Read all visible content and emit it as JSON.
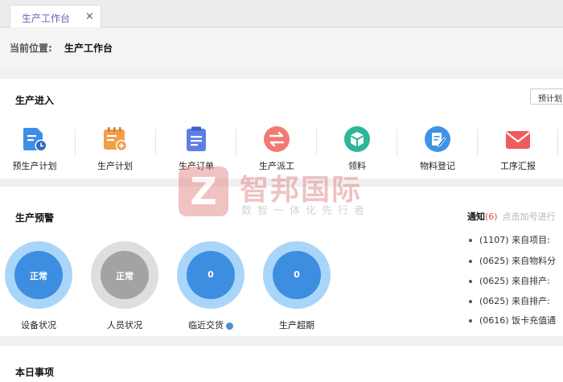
{
  "tabs": [
    {
      "label": "生产工作台",
      "close": "×"
    }
  ],
  "breadcrumb": {
    "label": "当前位置:",
    "value": "生产工作台"
  },
  "entry": {
    "title": "生产进入",
    "plan_button": "预计划",
    "items": [
      {
        "label": "预生产计划",
        "icon": "document-clock-icon",
        "color": "#3c8ee6"
      },
      {
        "label": "生产计划",
        "icon": "calendar-plus-icon",
        "color": "#f0a04a"
      },
      {
        "label": "生产订单",
        "icon": "clipboard-icon",
        "color": "#5e7ee6"
      },
      {
        "label": "生产派工",
        "icon": "swap-arrows-icon",
        "color": "#f37a73"
      },
      {
        "label": "领料",
        "icon": "box-icon",
        "color": "#2eb59a"
      },
      {
        "label": "物料登记",
        "icon": "edit-note-icon",
        "color": "#3f92e8"
      },
      {
        "label": "工序汇报",
        "icon": "envelope-icon",
        "color": "#ee5b5b"
      }
    ]
  },
  "warning": {
    "title": "生产预警",
    "gauges": [
      {
        "value": "正常",
        "label": "设备状况",
        "style": "blue"
      },
      {
        "value": "正常",
        "label": "人员状况",
        "style": "gray"
      },
      {
        "value": "0",
        "label": "临近交货",
        "style": "blue"
      },
      {
        "value": "0",
        "label": "生产超期",
        "style": "blue"
      }
    ]
  },
  "notices": {
    "title": "通知",
    "count": "(6)",
    "hint": "点击加号进行",
    "items": [
      "(1107) 来自项目:",
      "(0625) 来自物料分",
      "(0625) 来自排产:",
      "(0625) 来自排产:",
      "(0616) 饭卡充值通"
    ]
  },
  "today": {
    "title": "本日事项"
  },
  "watermark": {
    "logo": "Z",
    "name": "智邦国际",
    "slogan": "数智一体化先行者"
  },
  "colors": {
    "accent": "#3d8ee0",
    "tab_text": "#7a55b8",
    "notice_count": "#e34848"
  }
}
